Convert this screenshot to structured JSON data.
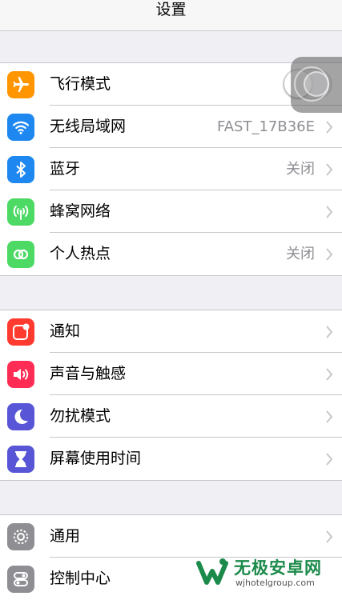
{
  "nav": {
    "title": "设置"
  },
  "group1": [
    {
      "label": "飞行模式",
      "icon": "airplane-icon",
      "color": "#ff9500",
      "toggle": false
    },
    {
      "label": "无线局域网",
      "icon": "wifi-icon",
      "color": "#1e88f0",
      "value": "FAST_17B36E"
    },
    {
      "label": "蓝牙",
      "icon": "bluetooth-icon",
      "color": "#1e88f0",
      "value": "关闭"
    },
    {
      "label": "蜂窝网络",
      "icon": "cellular-icon",
      "color": "#4cd964",
      "value": ""
    },
    {
      "label": "个人热点",
      "icon": "hotspot-icon",
      "color": "#4cd964",
      "value": "关闭"
    }
  ],
  "group2": [
    {
      "label": "通知",
      "icon": "notification-icon",
      "color": "#ff3b30"
    },
    {
      "label": "声音与触感",
      "icon": "sound-icon",
      "color": "#ff2d55"
    },
    {
      "label": "勿扰模式",
      "icon": "moon-icon",
      "color": "#5856d6"
    },
    {
      "label": "屏幕使用时间",
      "icon": "hourglass-icon",
      "color": "#5856d6"
    }
  ],
  "group3": [
    {
      "label": "通用",
      "icon": "gear-icon",
      "color": "#8e8e93"
    },
    {
      "label": "控制中心",
      "icon": "control-center-icon",
      "color": "#8e8e93"
    }
  ],
  "watermark": {
    "text": "无极安卓网",
    "url": "wjhotelgroup.com"
  }
}
